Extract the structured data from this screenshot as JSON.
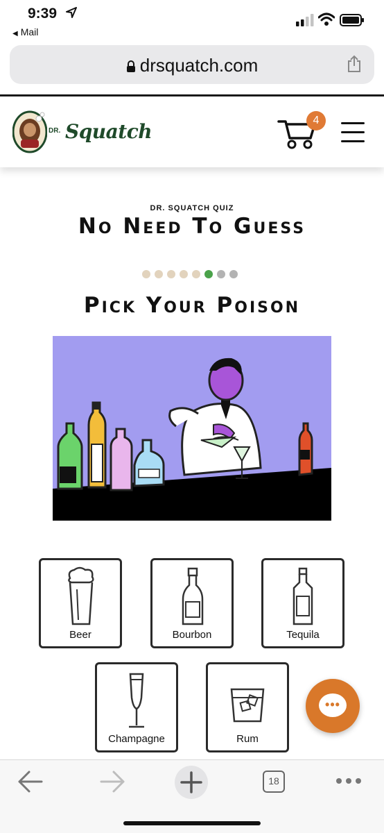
{
  "status_bar": {
    "time": "9:39",
    "back_app": "Mail"
  },
  "browser": {
    "url": "drsquatch.com",
    "tab_count": "18"
  },
  "header": {
    "logo_prefix": "DR.",
    "logo_text": "Squatch",
    "cart_count": "4"
  },
  "quiz": {
    "eyebrow": "DR. SQUATCH QUIZ",
    "headline": "No Need To Guess",
    "question": "Pick Your Poison",
    "progress": {
      "total": 8,
      "current": 6,
      "dot_colors": [
        "#e2d3bd",
        "#e2d3bd",
        "#e2d3bd",
        "#e2d3bd",
        "#e2d3bd",
        "#4aa24a",
        "#b3b3b3",
        "#b3b3b3"
      ]
    },
    "options": [
      {
        "label": "Beer",
        "icon": "beer-icon"
      },
      {
        "label": "Bourbon",
        "icon": "bourbon-icon"
      },
      {
        "label": "Tequila",
        "icon": "tequila-icon"
      },
      {
        "label": "Champagne",
        "icon": "champagne-icon"
      },
      {
        "label": "Rum",
        "icon": "rum-icon"
      }
    ]
  },
  "colors": {
    "brand_green": "#1f4a2a",
    "accent_orange": "#d9782a",
    "illustration_bg": "#a29cf0"
  },
  "chat": {
    "icon": "chat-bubble-icon"
  }
}
